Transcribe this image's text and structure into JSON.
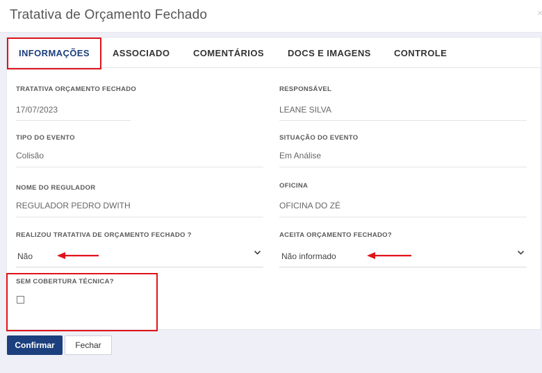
{
  "modal": {
    "title": "Tratativa de Orçamento Fechado",
    "close_label": "×"
  },
  "tabs": [
    {
      "label": "INFORMAÇÕES",
      "active": true
    },
    {
      "label": "ASSOCIADO",
      "active": false
    },
    {
      "label": "COMENTÁRIOS",
      "active": false
    },
    {
      "label": "DOCS E IMAGENS",
      "active": false
    },
    {
      "label": "CONTROLE",
      "active": false
    }
  ],
  "fields": {
    "tratativa": {
      "label": "TRATATIVA ORÇAMENTO FECHADO",
      "value": "17/07/2023"
    },
    "responsavel": {
      "label": "RESPONSÁVEL",
      "value": "LEANE SILVA"
    },
    "tipo_evento": {
      "label": "TIPO DO EVENTO",
      "value": "Colisão"
    },
    "situacao_evento": {
      "label": "SITUAÇÃO DO EVENTO",
      "value": "Em Análise"
    },
    "regulador": {
      "label": "NOME DO REGULADOR",
      "value": "REGULADOR PEDRO DWITH"
    },
    "oficina": {
      "label": "OFICINA",
      "value": "OFICINA DO ZÉ"
    },
    "realizou_tratativa": {
      "label": "REALIZOU TRATATIVA DE ORÇAMENTO FECHADO ?",
      "selected": "Não"
    },
    "aceita_orcamento": {
      "label": "ACEITA ORÇAMENTO FECHADO?",
      "selected": "Não informado"
    },
    "sem_cobertura": {
      "label": "SEM COBERTURA TÉCNICA?",
      "checked": false
    }
  },
  "buttons": {
    "confirm": "Confirmar",
    "close": "Fechar"
  },
  "colors": {
    "accent": "#1c3f7d",
    "highlight": "#e0131a"
  }
}
